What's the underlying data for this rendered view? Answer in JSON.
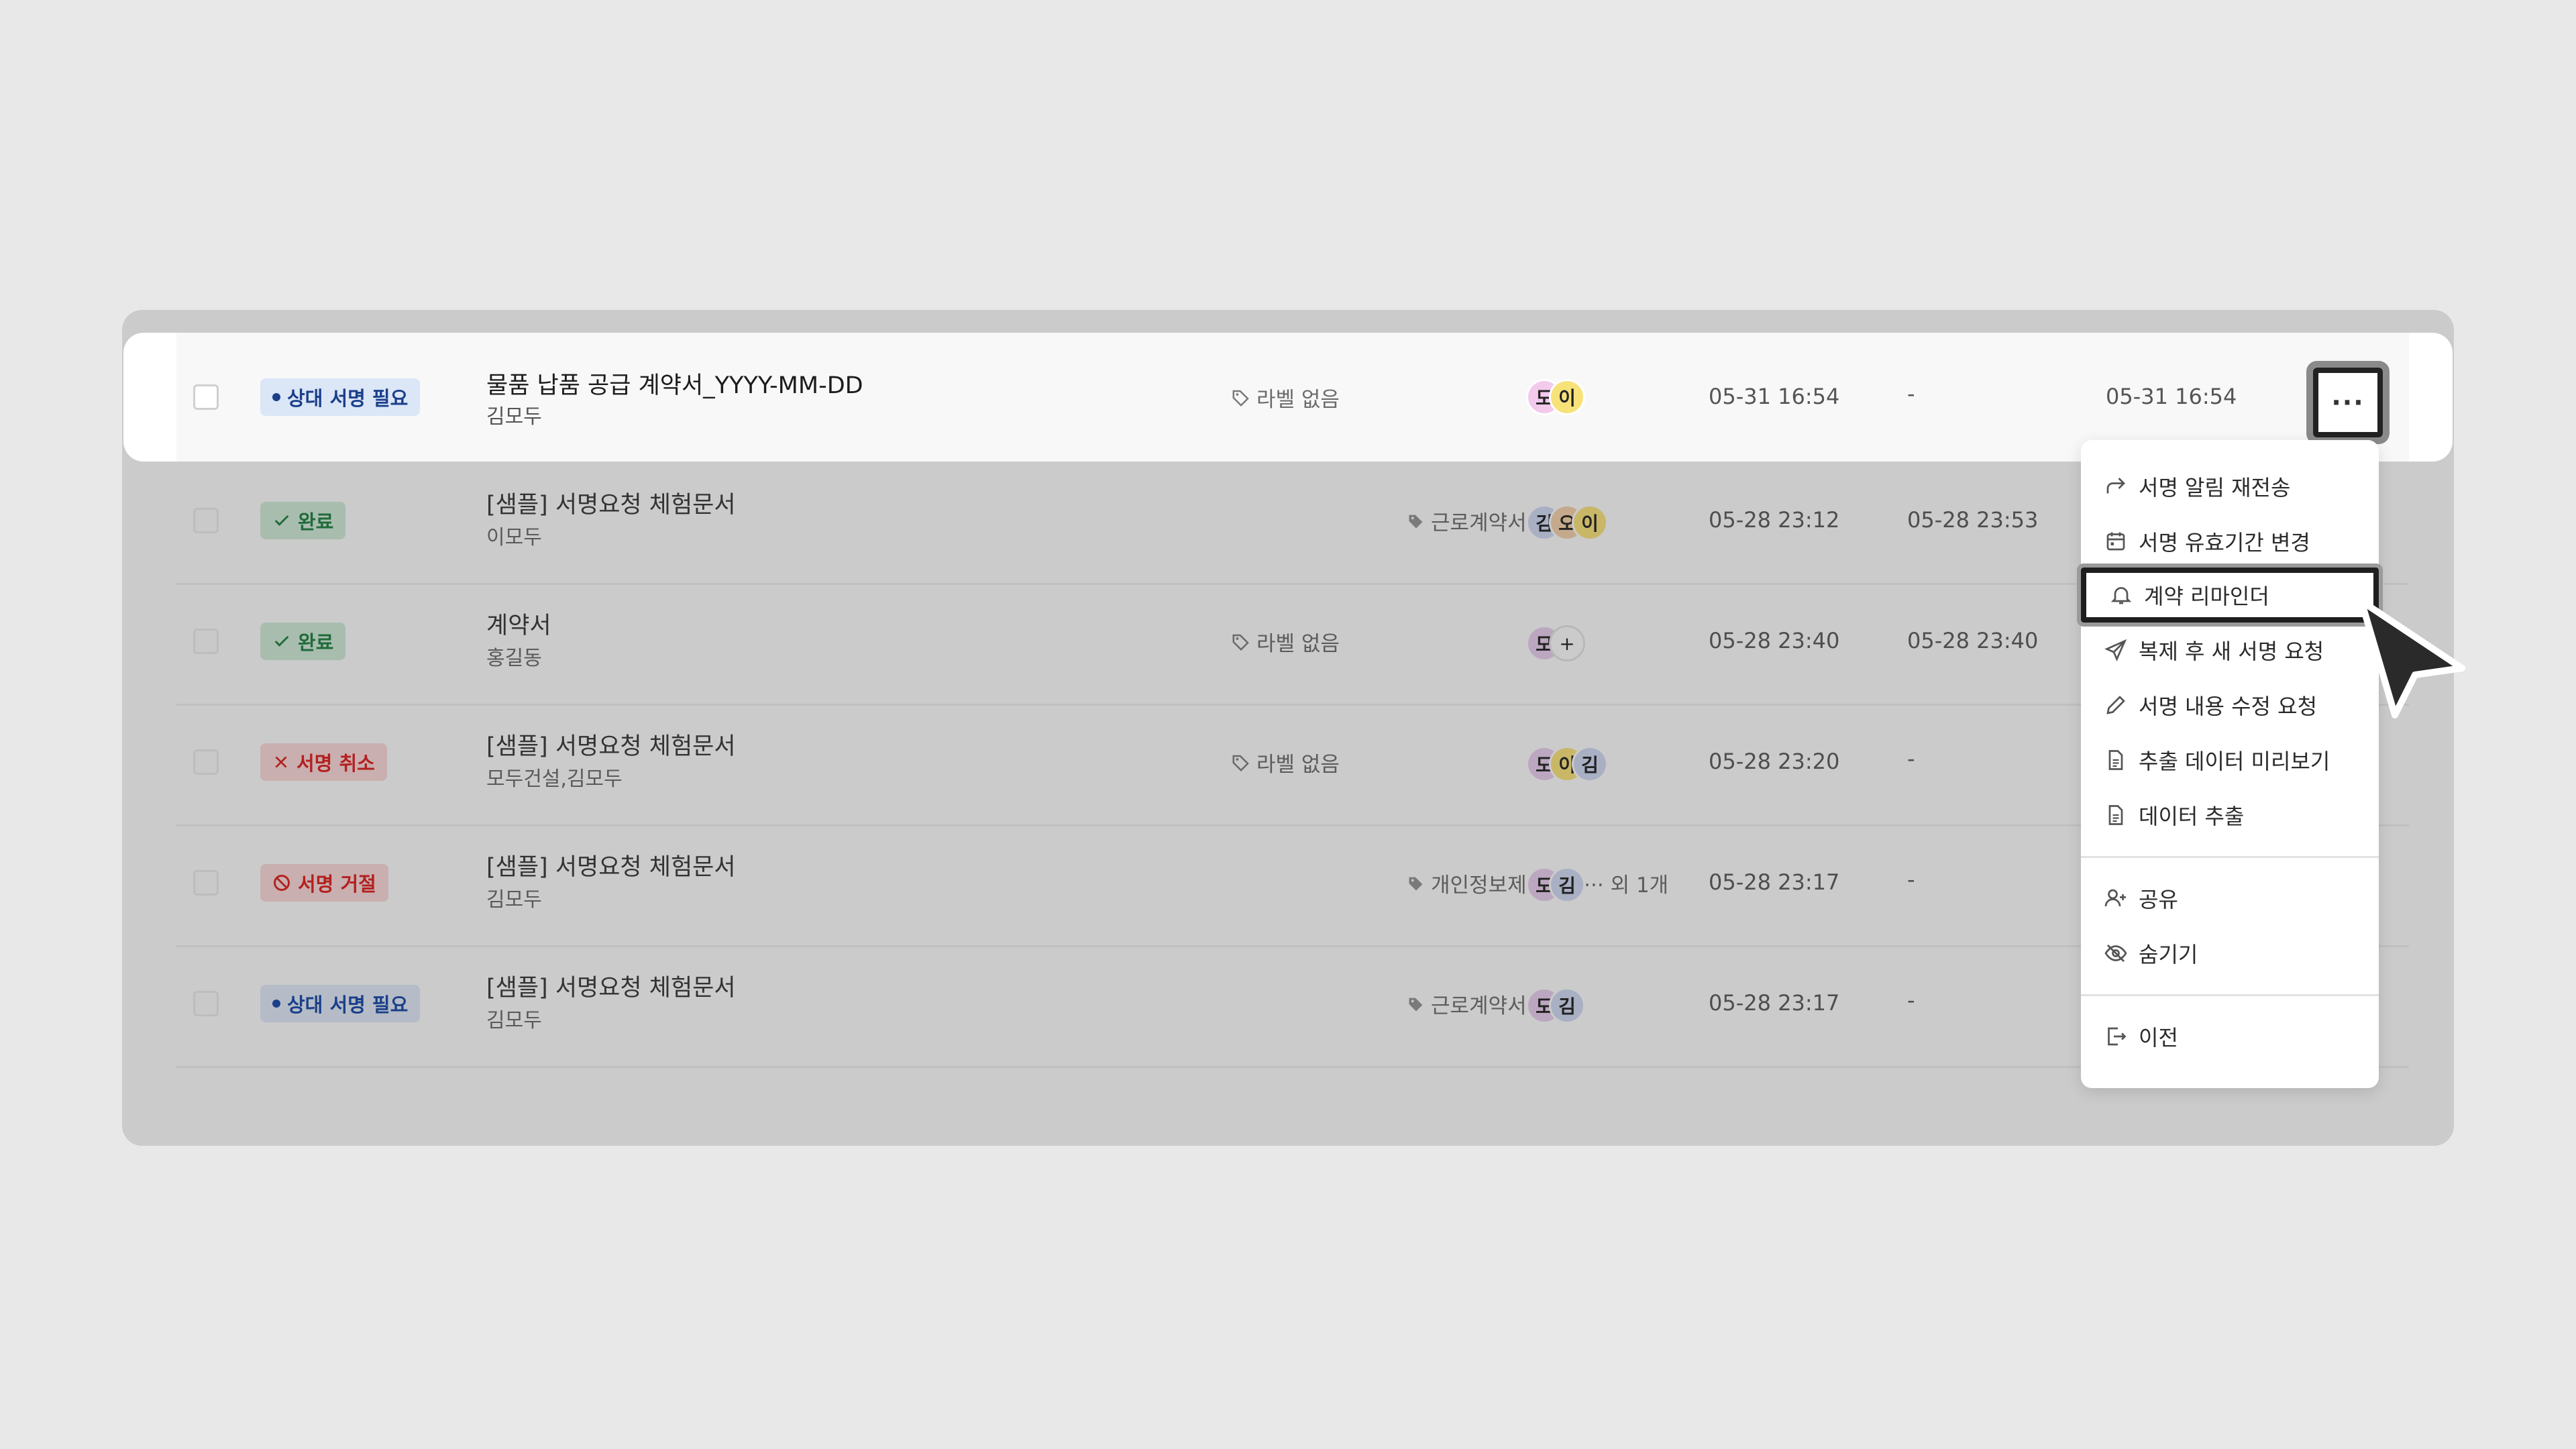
{
  "rows": [
    {
      "status": "상대 서명 필요",
      "status_icon": "dot-icon",
      "title": "물품 납품 공급 계약서_YYYY-MM-DD",
      "sub": "김모두",
      "label": "라벨 없음",
      "avatars": [
        "도",
        "이"
      ],
      "date1": "05-31 16:54",
      "date2": "-",
      "date3": "05-31 16:54"
    },
    {
      "status": "완료",
      "status_icon": "check-icon",
      "title": "[샘플] 서명요청 체험문서",
      "sub": "이모두",
      "label": "근로계약서",
      "avatars": [
        "김",
        "오",
        "이"
      ],
      "date1": "05-28 23:12",
      "date2": "05-28 23:53"
    },
    {
      "status": "완료",
      "status_icon": "check-icon",
      "title": "계약서",
      "sub": "홍길동",
      "label": "라벨 없음",
      "avatars": [
        "모",
        "+"
      ],
      "date1": "05-28 23:40",
      "date2": "05-28 23:40"
    },
    {
      "status": "서명 취소",
      "status_icon": "x-icon",
      "title": "[샘플] 서명요청 체험문서",
      "sub": "모두건설,김모두",
      "label": "라벨 없음",
      "avatars": [
        "도",
        "이",
        "김"
      ],
      "date1": "05-28 23:20",
      "date2": "-"
    },
    {
      "status": "서명 거절",
      "status_icon": "ban-icon",
      "title": "[샘플] 서명요청 체험문서",
      "sub": "김모두",
      "label": "개인정보제공활용··· 외 1개",
      "avatars": [
        "도",
        "김"
      ],
      "date1": "05-28 23:17",
      "date2": "-"
    },
    {
      "status": "상대 서명 필요",
      "status_icon": "dot-icon",
      "title": "[샘플] 서명요청 체험문서",
      "sub": "김모두",
      "label": "근로계약서",
      "avatars": [
        "도",
        "김"
      ],
      "date1": "05-28 23:17",
      "date2": "-"
    }
  ],
  "more_button_label": "···",
  "menu": {
    "items": [
      {
        "label": "서명 알림 재전송",
        "icon": "share-arrow-icon"
      },
      {
        "label": "서명 유효기간 변경",
        "icon": "calendar-icon"
      },
      {
        "label": "계약 리마인더",
        "icon": "bell-icon"
      },
      {
        "label": "복제 후 새 서명 요청",
        "icon": "send-icon"
      },
      {
        "label": "서명 내용 수정 요청",
        "icon": "pencil-icon"
      },
      {
        "label": "추출 데이터 미리보기",
        "icon": "document-icon"
      },
      {
        "label": "데이터 추출",
        "icon": "document-icon"
      },
      {
        "label": "공유",
        "icon": "user-plus-icon"
      },
      {
        "label": "숨기기",
        "icon": "eye-off-icon"
      },
      {
        "label": "이전",
        "icon": "export-icon"
      }
    ]
  },
  "colors": {
    "blue_badge": "#1b3f8a",
    "green_badge": "#1f6b3a",
    "red_badge": "#b42020",
    "avatar_pink": "#f3c9ec",
    "avatar_yellow": "#f7e27a",
    "avatar_blue": "#c9d3f2",
    "avatar_orange": "#f5c8a0"
  }
}
